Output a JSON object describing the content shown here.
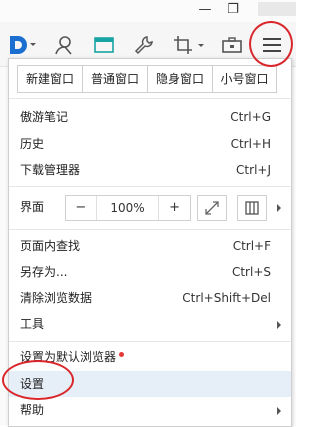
{
  "window_controls": {
    "minimize": "—",
    "restore": "❐"
  },
  "toolbar": {
    "icons": [
      "browser-logo-icon",
      "user-icon",
      "screen-icon",
      "wrench-icon",
      "crop-icon",
      "toolbox-icon",
      "menu-icon"
    ]
  },
  "menu": {
    "window_tabs": [
      "新建窗口",
      "普通窗口",
      "隐身窗口",
      "小号窗口"
    ],
    "items_group1": [
      {
        "label": "傲游笔记",
        "shortcut": "Ctrl+G"
      },
      {
        "label": "历史",
        "shortcut": "Ctrl+H"
      },
      {
        "label": "下载管理器",
        "shortcut": "Ctrl+J"
      }
    ],
    "interface": {
      "label": "界面",
      "zoom_out": "−",
      "zoom_value": "100%",
      "zoom_in": "+"
    },
    "items_group2": [
      {
        "label": "页面内查找",
        "shortcut": "Ctrl+F"
      },
      {
        "label": "另存为...",
        "shortcut": "Ctrl+S"
      },
      {
        "label": "清除浏览数据",
        "shortcut": "Ctrl+Shift+Del"
      }
    ],
    "tools": {
      "label": "工具"
    },
    "set_default": {
      "label": "设置为默认浏览器"
    },
    "settings": {
      "label": "设置"
    },
    "help": {
      "label": "帮助"
    }
  },
  "colors": {
    "highlight_ring": "#d8262a",
    "badge": "#e53935",
    "selected_bg": "#e6eef8",
    "logo": "#1a6fd1"
  }
}
